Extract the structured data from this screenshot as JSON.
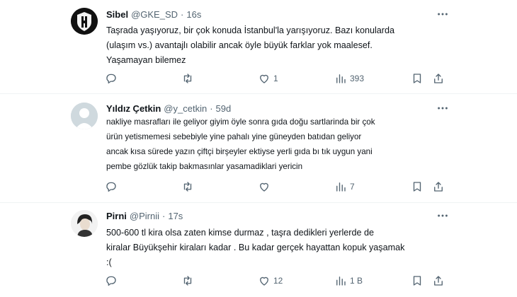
{
  "tweets": [
    {
      "name": "Sibel",
      "handle": "@GKE_SD",
      "dot": "·",
      "time": "16s",
      "lines": [
        "Taşrada yaşıyoruz, bir çok konuda İstanbul'la yarışıyoruz. Bazı konularda",
        "(ulaşım vs.) avantajlı olabilir ancak öyle büyük farklar yok maalesef.",
        "Yaşamayan bilemez"
      ],
      "likes": "1",
      "views": "393",
      "avatar": "club-crest-avatar"
    },
    {
      "name": "Yıldız Çetkin",
      "handle": "@y_cetkin",
      "dot": "·",
      "time": "59d",
      "lines": [
        "nakliye masrafları ile geliyor giyim öyle  sonra gıda doğu sartlarinda bir çok",
        "ürün yetismemesi sebebiyle yine pahalı yine güneyden batıdan geliyor",
        "ancak kısa sürede yazın çiftçi birşeyler ektiyse yerli gıda bı tık uygun yani",
        "pembe gözlük takip bakmasınlar yasamadiklari yericin"
      ],
      "likes": "",
      "views": "7",
      "avatar": "default-avatar"
    },
    {
      "name": "Pirni",
      "handle": "@Pirnii",
      "dot": "·",
      "time": "17s",
      "lines": [
        "500-600 tl kira olsa zaten kimse durmaz , taşra dedikleri yerlerde de",
        "kiralar Büyükşehir kiraları kadar . Bu kadar gerçek hayattan kopuk yaşamak",
        ":("
      ],
      "likes": "12",
      "views": "1 B",
      "avatar": "portrait-avatar"
    }
  ],
  "colors": {
    "text": "#0f1419",
    "muted": "#536471",
    "border": "#eff3f4"
  }
}
